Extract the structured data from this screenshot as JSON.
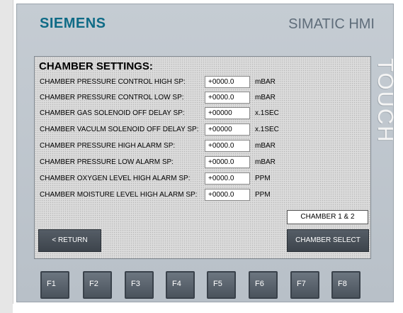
{
  "header": {
    "brand": "SIEMENS",
    "model": "SIMATIC HMI",
    "touch_label": "TOUCH"
  },
  "screen": {
    "title": "CHAMBER SETTINGS:",
    "rows": [
      {
        "label": "CHAMBER PRESSURE CONTROL HIGH SP:",
        "value": "+0000.0",
        "unit": "mBAR"
      },
      {
        "label": "CHAMBER PRESSURE CONTROL LOW SP:",
        "value": "+0000.0",
        "unit": "mBAR"
      },
      {
        "label": "CHAMBER GAS SOLENOID OFF DELAY SP:",
        "value": "+00000",
        "unit": "x.1SEC"
      },
      {
        "label": "CHAMBER VACULM SOLENOID OFF DELAY SP:",
        "value": "+00000",
        "unit": "x.1SEC"
      },
      {
        "label": "CHAMBER PRESSURE HIGH ALARM SP:",
        "value": "+0000.0",
        "unit": "mBAR"
      },
      {
        "label": "CHAMBER PRESSURE LOW ALARM SP:",
        "value": "+0000.0",
        "unit": "mBAR"
      },
      {
        "label": "CHAMBER OXYGEN LEVEL HIGH ALARM SP:",
        "value": "+0000.0",
        "unit": "PPM"
      },
      {
        "label": "CHAMBER MOISTURE LEVEL HIGH ALARM SP:",
        "value": "+0000.0",
        "unit": "PPM"
      }
    ],
    "chamber_indicator": "CHAMBER 1 & 2",
    "return_button": "< RETURN",
    "chamber_select_button": "CHAMBER SELECT"
  },
  "function_keys": [
    "F1",
    "F2",
    "F3",
    "F4",
    "F5",
    "F6",
    "F7",
    "F8"
  ],
  "colors": {
    "brand": "#0f6b86",
    "panel": "#c0c7ce",
    "button": "#4a535c"
  }
}
